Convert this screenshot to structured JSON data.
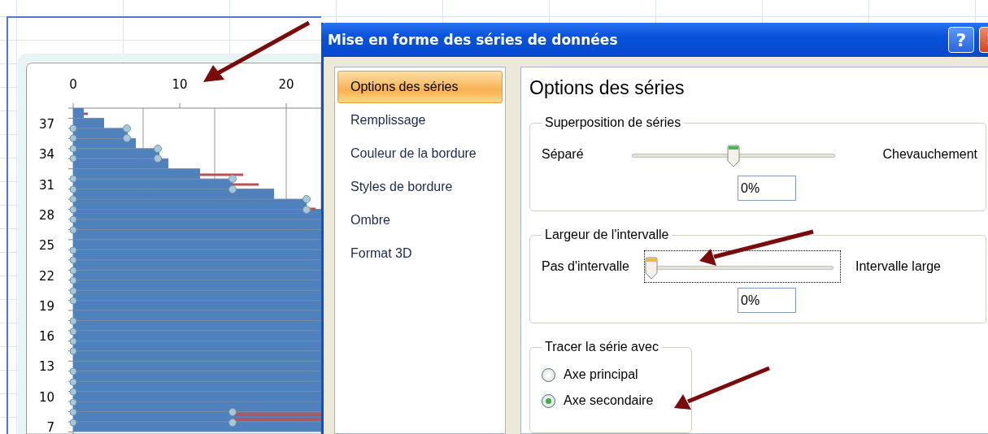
{
  "chart": {
    "x_tick_labels": [
      "0",
      "10",
      "20"
    ],
    "y_tick_labels": [
      "37",
      "34",
      "31",
      "28",
      "25",
      "22",
      "19",
      "16",
      "13",
      "10",
      "7"
    ]
  },
  "dialog": {
    "title": "Mise en forme des séries de données",
    "help_button": "?",
    "nav": [
      {
        "label": "Options des séries",
        "selected": true
      },
      {
        "label": "Remplissage",
        "selected": false
      },
      {
        "label": "Couleur de la bordure",
        "selected": false
      },
      {
        "label": "Styles de bordure",
        "selected": false
      },
      {
        "label": "Ombre",
        "selected": false
      },
      {
        "label": "Format 3D",
        "selected": false
      }
    ],
    "panel": {
      "heading": "Options des séries",
      "overlap": {
        "title": "Superposition de séries",
        "left_label": "Séparé",
        "right_label": "Chevauchement",
        "level": 0.5,
        "value": "0%",
        "focused": false
      },
      "gap": {
        "title": "Largeur de l'intervalle",
        "left_label": "Pas d'intervalle",
        "right_label": "Intervalle large",
        "level": 0,
        "value": "0%",
        "focused": true
      },
      "plot_on": {
        "title": "Tracer la série avec",
        "options": [
          {
            "label": "Axe principal",
            "selected": false
          },
          {
            "label": "Axe secondaire",
            "selected": true
          }
        ]
      }
    }
  }
}
